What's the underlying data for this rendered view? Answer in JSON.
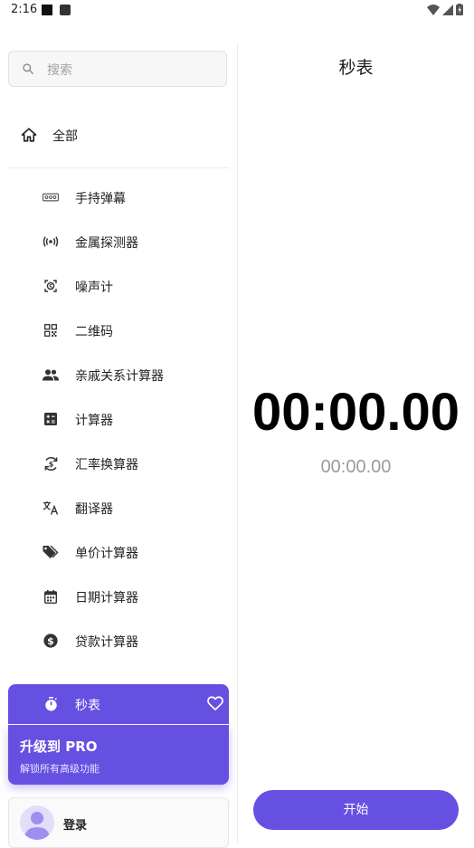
{
  "status_bar": {
    "time": "2:16"
  },
  "sidebar": {
    "search_placeholder": "搜索",
    "all_label": "全部",
    "items": [
      {
        "label": "手持弹幕",
        "icon": "marquee-icon"
      },
      {
        "label": "金属探测器",
        "icon": "radar-signal-icon"
      },
      {
        "label": "噪声计",
        "icon": "noise-meter-icon"
      },
      {
        "label": "二维码",
        "icon": "qr-code-icon"
      },
      {
        "label": "亲戚关系计算器",
        "icon": "people-icon"
      },
      {
        "label": "计算器",
        "icon": "calculator-icon"
      },
      {
        "label": "汇率换算器",
        "icon": "currency-exchange-icon"
      },
      {
        "label": "翻译器",
        "icon": "translate-icon"
      },
      {
        "label": "单价计算器",
        "icon": "price-tag-icon"
      },
      {
        "label": "日期计算器",
        "icon": "calendar-icon"
      },
      {
        "label": "贷款计算器",
        "icon": "dollar-circle-icon"
      },
      {
        "label": "秒表",
        "icon": "stopwatch-icon"
      }
    ],
    "pro": {
      "title": "升级到 PRO",
      "subtitle": "解锁所有高级功能"
    },
    "login_label": "登录"
  },
  "main": {
    "title": "秒表",
    "timer": "00:00.00",
    "lap_timer": "00:00.00",
    "start_label": "开始"
  },
  "colors": {
    "accent": "#6650e2"
  }
}
